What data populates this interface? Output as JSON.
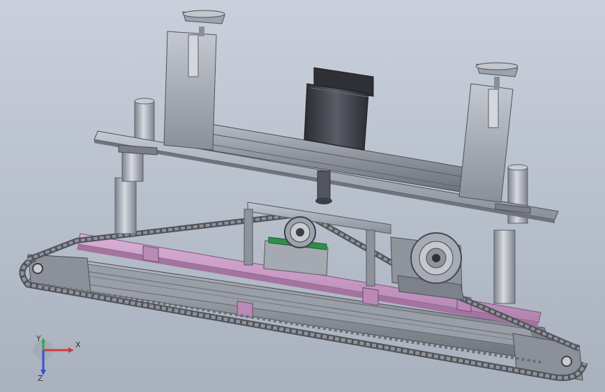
{
  "triad": {
    "x_label": "X",
    "y_label": "Y",
    "z_label": "Z",
    "x_color": "#d23a3a",
    "y_color": "#2fa84a",
    "z_color": "#3b4fd0"
  },
  "colors": {
    "background_top": "#c9d0db",
    "background_bottom": "#a9b1be",
    "steel": "#9ea3ad",
    "dark_steel": "#4e5058",
    "pink_plate": "#c99cc7",
    "motor": "#3a3c44",
    "sprocket_base": "#2f8f4a"
  }
}
